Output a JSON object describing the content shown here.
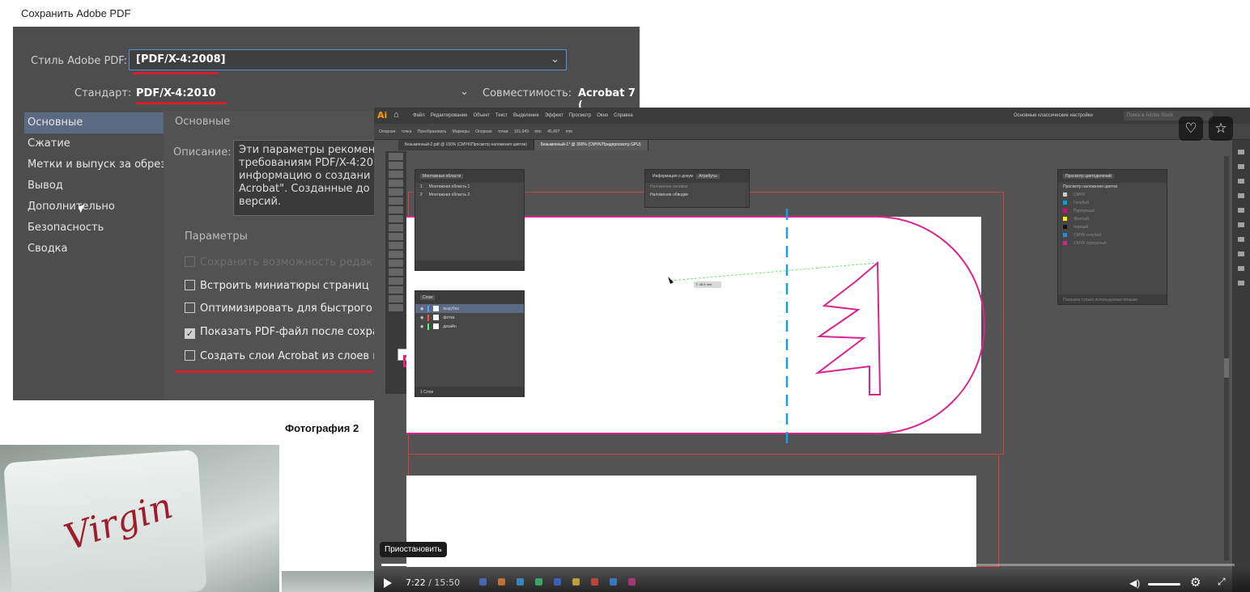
{
  "dialog": {
    "caption": "Сохранить Adobe PDF",
    "style_label": "Стиль Adobe PDF:",
    "style_value": "[PDF/X-4:2008]",
    "standard_label": "Стандарт:",
    "standard_value": "PDF/X-4:2010",
    "compat_label": "Совместимость:",
    "compat_value": "Acrobat 7 (",
    "sidebar": [
      "Основные",
      "Сжатие",
      "Метки и выпуск за обрез",
      "Вывод",
      "Дополнительно",
      "Безопасность",
      "Сводка"
    ],
    "section_title": "Основные",
    "description_label": "Описание:",
    "description_text": "Эти параметры рекомен требованиям PDF/X-4:20 информацию о создани Acrobat\". Созданные до версий.",
    "params_title": "Параметры",
    "checkboxes": [
      {
        "label": "Сохранить возможность редакт",
        "checked": false,
        "disabled": true
      },
      {
        "label": "Встроить миниатюры страниц",
        "checked": false,
        "disabled": false
      },
      {
        "label": "Оптимизировать для быстрого п",
        "checked": false,
        "disabled": false
      },
      {
        "label": "Показать PDF-файл после сохра",
        "checked": true,
        "disabled": false
      },
      {
        "label": "Создать слои Acrobat из слоев в",
        "checked": false,
        "disabled": false
      }
    ]
  },
  "photo_caption": "Фотография 2",
  "photo_logo": "Virgin",
  "video": {
    "ai_logo": "Ai",
    "menu": [
      "Файл",
      "Редактирование",
      "Объект",
      "Текст",
      "Выделение",
      "Эффект",
      "Просмотр",
      "Окно",
      "Справка"
    ],
    "workspace": "Основные классические настройки",
    "search_placeholder": "Поиск в Adobe Stock",
    "control_bar": "Опорная точка Преобразовать Маркеры Опорная точки 101,949 mm 45,497 mm",
    "tabs": [
      {
        "label": "Безымянный-2.pdf @ 150% (CMYK/Просмотр наложения цветов)",
        "active": false
      },
      {
        "label": "Безымянный-1* @ 300% (CMYK/Предпросмотр GPU)",
        "active": true
      }
    ],
    "artboards_panel": {
      "title": "Монтажные области",
      "rows": [
        {
          "num": "1",
          "name": "Монтажная область 1"
        },
        {
          "num": "2",
          "name": "Монтажная область 2"
        }
      ]
    },
    "attributes_panel": {
      "tabs": [
        "Информация о докум",
        "Атрибуты"
      ],
      "options": [
        "Наложение заливки",
        "Наложение обводки"
      ]
    },
    "separations_panel": {
      "title": "Просмотр цветоделений",
      "option": "Просмотр наложения цветов",
      "inks": [
        {
          "name": "CMYK",
          "color": "#cccccc"
        },
        {
          "name": "Голубой",
          "color": "#00a0e3"
        },
        {
          "name": "Пурпурный",
          "color": "#e5007e"
        },
        {
          "name": "Желтый",
          "color": "#ffed00"
        },
        {
          "name": "Черный",
          "color": "#111111"
        },
        {
          "name": "CMYK голубой",
          "color": "#2b8be0"
        },
        {
          "name": "CMYK пурпурный",
          "color": "#d9238e"
        }
      ],
      "footer": "Показать только используемые плашки"
    },
    "layers_panel": {
      "title": "Слои",
      "rows": [
        {
          "name": "вырубка",
          "color": "#4da3ff",
          "selected": true
        },
        {
          "name": "фотка",
          "color": "#ff4d4d",
          "selected": false
        },
        {
          "name": "дизайн",
          "color": "#4dff6a",
          "selected": false
        }
      ],
      "footer": "1 Слои"
    },
    "measure_tag": "Т: 48,6 mm",
    "tooltip": "Приостановить",
    "time_current": "7:22",
    "time_total": "15:50",
    "progress": 0.465,
    "buffered": 0.52,
    "colors": {
      "magenta": "#d9238e",
      "cyan_guide": "#1e9be8",
      "red_guide": "#e23b3b",
      "green_path": "#7be07b"
    },
    "icons": {
      "like": "heart-icon",
      "favorite": "star-icon",
      "play": "play-icon",
      "volume": "volume-icon",
      "settings": "gear-icon",
      "fullscreen": "fullscreen-icon"
    }
  }
}
